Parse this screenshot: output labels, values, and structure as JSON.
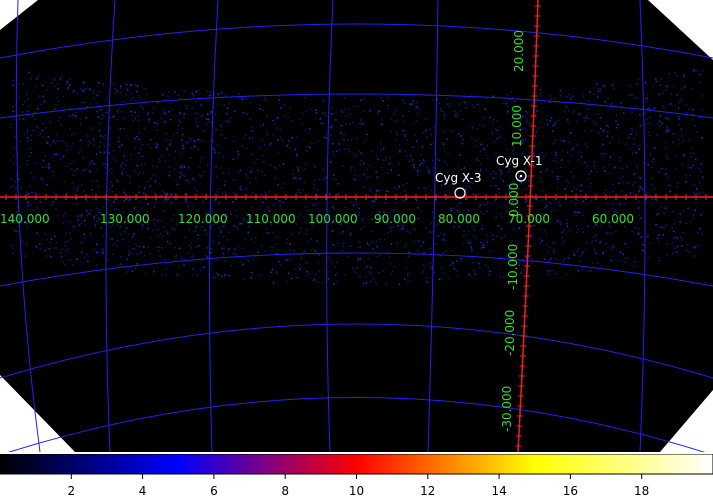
{
  "sky_map": {
    "sources": [
      {
        "name": "Cyg X-1",
        "glon": 71.3,
        "glat": 3.1
      },
      {
        "name": "Cyg X-3",
        "glon": 79.8,
        "glat": 0.7
      }
    ],
    "lon_labels": [
      "140.000",
      "130.000",
      "120.000",
      "110.000",
      "100.000",
      "90.000",
      "80.000",
      "70.000",
      "60.000"
    ],
    "lat_labels": [
      "20.000",
      "10.000",
      "0.000",
      "-10.000",
      "-20.000",
      "-30.000"
    ],
    "colors": {
      "grid": "#2222ee",
      "axes": "#ee2222",
      "labels": "#33dd33",
      "background": "#000000",
      "source_markers": "#ffffff"
    }
  },
  "colorbar": {
    "min": 0,
    "max": 20,
    "tick_labels": [
      "2",
      "4",
      "6",
      "8",
      "10",
      "12",
      "14",
      "16",
      "18"
    ],
    "colormap": "bb"
  }
}
